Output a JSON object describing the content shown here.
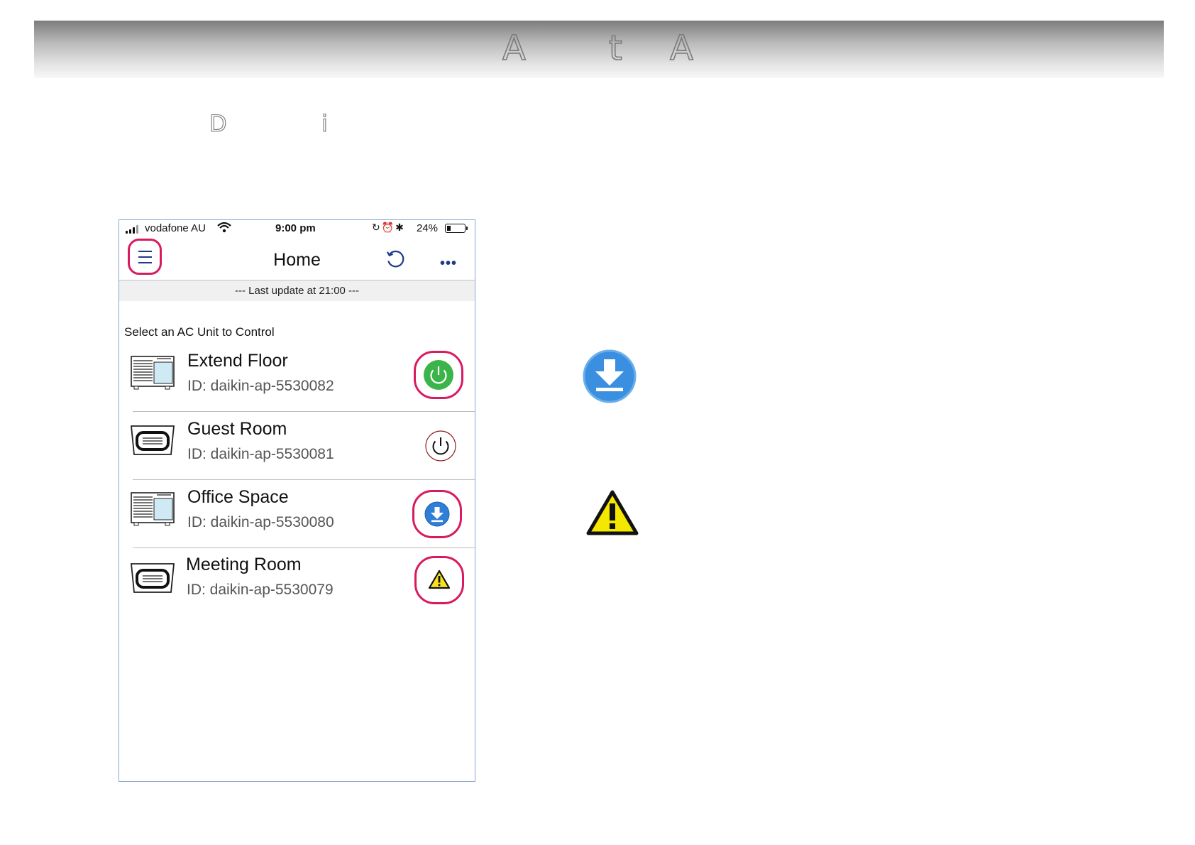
{
  "slide": {
    "banner_letters": [
      "A",
      "t",
      "A"
    ],
    "subtitle_letters": [
      "D",
      "i"
    ]
  },
  "phone": {
    "status_bar": {
      "carrier": "vodafone AU",
      "time": "9:00 pm",
      "battery_percent": "24%",
      "battery_level": 0.24
    },
    "nav": {
      "title": "Home",
      "menu_icon": "hamburger-menu-icon",
      "refresh_icon": "refresh-icon",
      "more_label": "•••"
    },
    "last_update": "--- Last update at 21:00 ---",
    "prompt": "Select an  AC Unit to Control",
    "units": [
      {
        "name": "Extend Floor",
        "id": "ID: daikin-ap-5530082",
        "unit_icon": "wall-unit-icon",
        "status": "power-on",
        "status_icon": "power-on-icon",
        "status_color": "#3bb54a",
        "highlighted": true
      },
      {
        "name": "Guest Room",
        "id": "ID: daikin-ap-5530081",
        "unit_icon": "ceiling-cassette-icon",
        "status": "power-off",
        "status_icon": "power-off-icon",
        "status_color": "#ffffff",
        "highlighted": false
      },
      {
        "name": "Office Space",
        "id": "ID: daikin-ap-5530080",
        "unit_icon": "wall-unit-icon",
        "status": "download",
        "status_icon": "download-icon",
        "status_color": "#2f7fd8",
        "highlighted": true
      },
      {
        "name": "Meeting Room",
        "id": "ID: daikin-ap-5530079",
        "unit_icon": "ceiling-cassette-icon",
        "status": "warning",
        "status_icon": "warning-icon",
        "status_color": "#f7e11c",
        "highlighted": true
      }
    ]
  },
  "legend": [
    {
      "icon": "download-icon",
      "color": "#3b8fe0"
    },
    {
      "icon": "warning-icon",
      "color": "#f4e800"
    }
  ],
  "colors": {
    "highlight_ring": "#d81b60",
    "nav_accent": "#1e3a8a",
    "phone_border": "#8aa4cf"
  }
}
